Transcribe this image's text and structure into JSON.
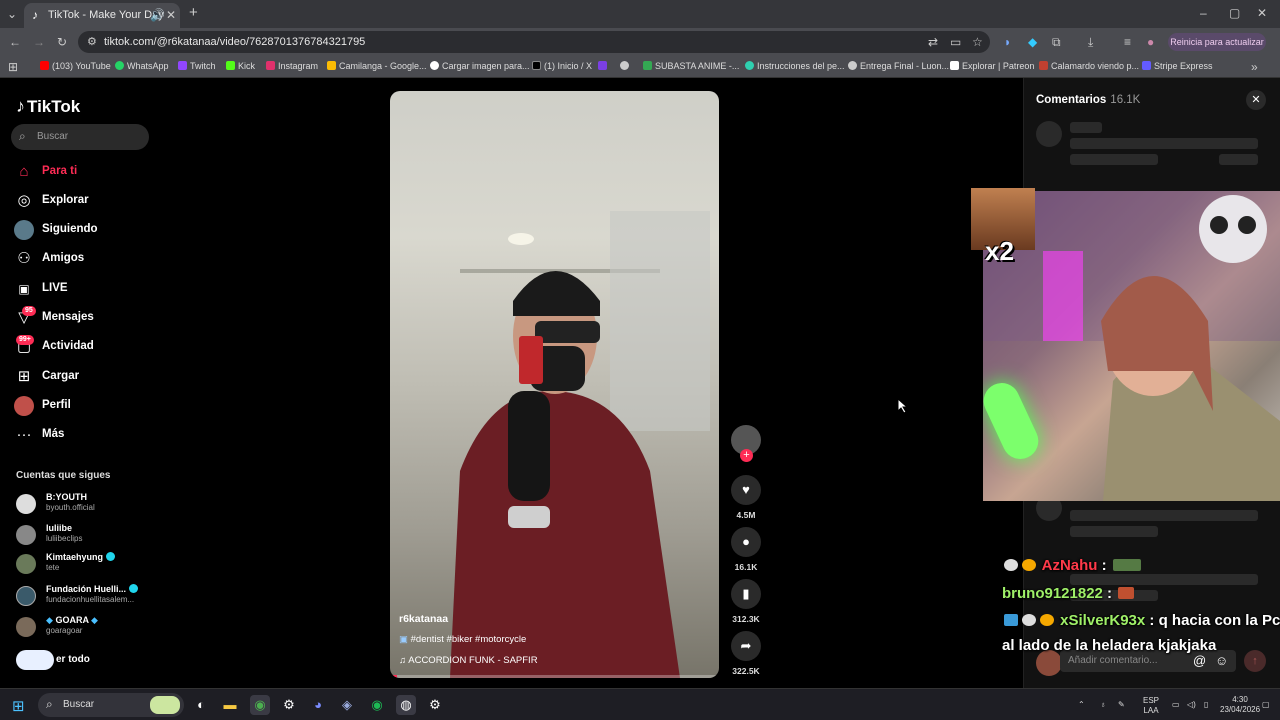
{
  "browser": {
    "tab_title": "TikTok - Make Your Day",
    "url": "tiktok.com/@r6katanaa/video/7628701376784321795",
    "update_button": "Reinicia para actualizar",
    "bookmarks": [
      {
        "label": "(103) YouTube",
        "color": "#ff0000"
      },
      {
        "label": "WhatsApp",
        "color": "#25d366"
      },
      {
        "label": "Twitch",
        "color": "#9146ff"
      },
      {
        "label": "Kick",
        "color": "#53fc18"
      },
      {
        "label": "Instagram",
        "color": "#e1306c"
      },
      {
        "label": "Camilanga - Google...",
        "color": "#fbbc04"
      },
      {
        "label": "Cargar imagen para...",
        "color": "#ffffff"
      },
      {
        "label": "(1) Inicio / X",
        "color": "#000000"
      },
      {
        "label": "",
        "color": "#7b3fe4"
      },
      {
        "label": "",
        "color": "#cccccc"
      },
      {
        "label": "SUBASTA ANIME -...",
        "color": "#34a853"
      },
      {
        "label": "Instrucciones del pe...",
        "color": "#2fd0b0"
      },
      {
        "label": "Entrega Final - Luon...",
        "color": "#cccccc"
      },
      {
        "label": "Explorar | Patreon",
        "color": "#ffffff"
      },
      {
        "label": "Calamardo viendo p...",
        "color": "#c04030"
      },
      {
        "label": "Stripe Express",
        "color": "#635bff"
      }
    ]
  },
  "tiktok": {
    "logo": "TikTok",
    "search_placeholder": "Buscar",
    "nav": [
      {
        "label": "Para ti",
        "icon": "home-icon",
        "active": true
      },
      {
        "label": "Explorar",
        "icon": "compass-icon"
      },
      {
        "label": "Siguiendo",
        "icon": "following-avatar-icon"
      },
      {
        "label": "Amigos",
        "icon": "friends-icon"
      },
      {
        "label": "LIVE",
        "icon": "live-icon"
      },
      {
        "label": "Mensajes",
        "icon": "messages-icon",
        "badge": "95"
      },
      {
        "label": "Actividad",
        "icon": "activity-icon",
        "badge": "99+"
      },
      {
        "label": "Cargar",
        "icon": "upload-icon"
      },
      {
        "label": "Perfil",
        "icon": "profile-avatar-icon"
      },
      {
        "label": "Más",
        "icon": "more-icon"
      }
    ],
    "following_header": "Cuentas que sigues",
    "following": [
      {
        "name": "B:YOUTH",
        "handle": "byouth.official",
        "verified": false
      },
      {
        "name": "luliibe",
        "handle": "luliibeclips",
        "verified": false
      },
      {
        "name": "Kimtaehyung",
        "handle": "tete",
        "verified": true
      },
      {
        "name": "Fundación Huelli...",
        "handle": "fundacionhuellitasalem...",
        "verified": true
      },
      {
        "name": "GOARA",
        "handle": "goaragoar",
        "verified": true
      }
    ],
    "see_all": "er todo"
  },
  "video": {
    "author": "r6katanaa",
    "hashtags": "#dentist #biker #motorcycle",
    "music": "ACCORDION FUNK - SAPFIR",
    "progress": 0.02,
    "likes": "4.5M",
    "comments": "16.1K",
    "saves": "312.3K",
    "shares": "322.5K"
  },
  "comments_panel": {
    "title": "Comentarios",
    "count": "16.1K",
    "input_placeholder": "Añadir comentario..."
  },
  "overlay": {
    "multiplier": "x2",
    "chat": [
      {
        "user": "AzNahu",
        "sep": " : ",
        "text": ""
      },
      {
        "user": "bruno9121822",
        "sep": " : ",
        "text": ""
      },
      {
        "user": "xSilverK93x",
        "sep": " : ",
        "text": "q hacia con la Pc"
      },
      {
        "user": "",
        "sep": "",
        "text": "al lado de la heladera kjakjaka"
      }
    ]
  },
  "taskbar": {
    "search_placeholder": "Buscar",
    "lang": "ESP",
    "lang2": "LAA",
    "time": "4:30",
    "date": "23/04/2026"
  }
}
